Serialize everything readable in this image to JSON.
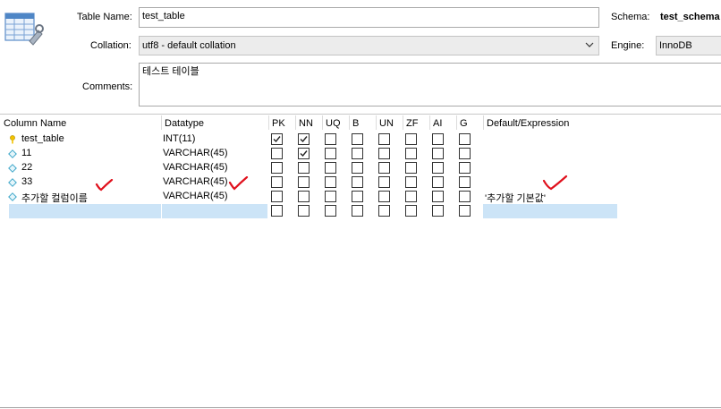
{
  "header": {
    "table_name_label": "Table Name:",
    "table_name_value": "test_table",
    "schema_label": "Schema:",
    "schema_value": "test_schema",
    "collation_label": "Collation:",
    "collation_value": "utf8 - default collation",
    "engine_label": "Engine:",
    "engine_value": "InnoDB",
    "comments_label": "Comments:",
    "comments_value": "테스트 테이블"
  },
  "grid": {
    "columns": [
      "Column Name",
      "Datatype",
      "PK",
      "NN",
      "UQ",
      "B",
      "UN",
      "ZF",
      "AI",
      "G",
      "Default/Expression"
    ],
    "rows": [
      {
        "icon": "primary-key-icon",
        "name": "test_table",
        "datatype": "INT(11)",
        "flags": [
          true,
          true,
          false,
          false,
          false,
          false,
          false,
          false
        ],
        "default": ""
      },
      {
        "icon": "column-diamond-icon",
        "name": "11",
        "datatype": "VARCHAR(45)",
        "flags": [
          false,
          true,
          false,
          false,
          false,
          false,
          false,
          false
        ],
        "default": ""
      },
      {
        "icon": "column-diamond-icon",
        "name": "22",
        "datatype": "VARCHAR(45)",
        "flags": [
          false,
          false,
          false,
          false,
          false,
          false,
          false,
          false
        ],
        "default": ""
      },
      {
        "icon": "column-diamond-icon",
        "name": "33",
        "datatype": "VARCHAR(45)",
        "flags": [
          false,
          false,
          false,
          false,
          false,
          false,
          false,
          false
        ],
        "default": ""
      },
      {
        "icon": "column-diamond-icon",
        "name": "추가할 컬럼이름",
        "datatype": "VARCHAR(45)",
        "flags": [
          false,
          false,
          false,
          false,
          false,
          false,
          false,
          false
        ],
        "default": "'추가할 기본값'"
      }
    ]
  },
  "colors": {
    "new_row_highlight": "#cce4f7",
    "annotation_tick": "#e0101c",
    "key_icon": "#f2c200",
    "diamond_icon": "#3fa7c9"
  }
}
